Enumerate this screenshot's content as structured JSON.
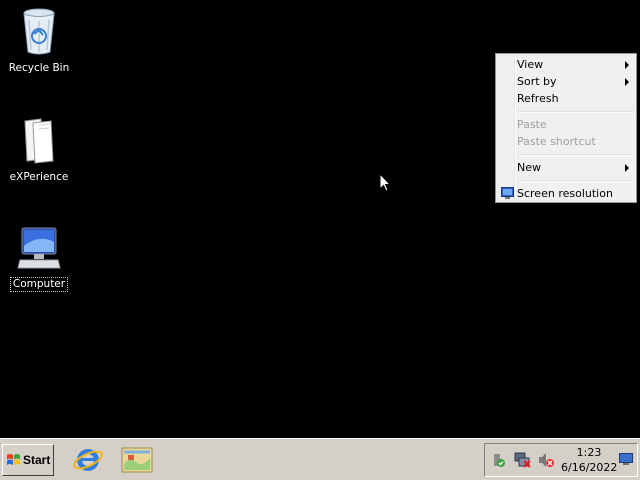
{
  "desktop": {
    "icons": [
      {
        "label": "Recycle Bin",
        "icon": "recycle-bin-icon"
      },
      {
        "label": "eXPerience",
        "icon": "folder-icon"
      },
      {
        "label": "Computer",
        "icon": "computer-icon",
        "selected": true
      }
    ]
  },
  "context_menu": {
    "items": [
      {
        "label": "View",
        "submenu": true
      },
      {
        "label": "Sort by",
        "submenu": true
      },
      {
        "label": "Refresh"
      },
      {
        "label": "Paste",
        "disabled": true
      },
      {
        "label": "Paste shortcut",
        "disabled": true
      },
      {
        "label": "New",
        "submenu": true
      },
      {
        "label": "Screen resolution",
        "icon": "screen-resolution-icon"
      }
    ]
  },
  "taskbar": {
    "start_label": "Start",
    "quick_launch": [
      "internet-explorer-icon",
      "show-desktop-icon"
    ],
    "tray_icons": [
      "action-center-icon",
      "network-disconnected-icon",
      "volume-muted-icon"
    ],
    "time": "1:23",
    "date": "6/16/2022"
  },
  "colors": {
    "desktop_bg": "#000000",
    "taskbar_bg": "#d4d0c8",
    "menu_bg": "#f0f0f0"
  }
}
